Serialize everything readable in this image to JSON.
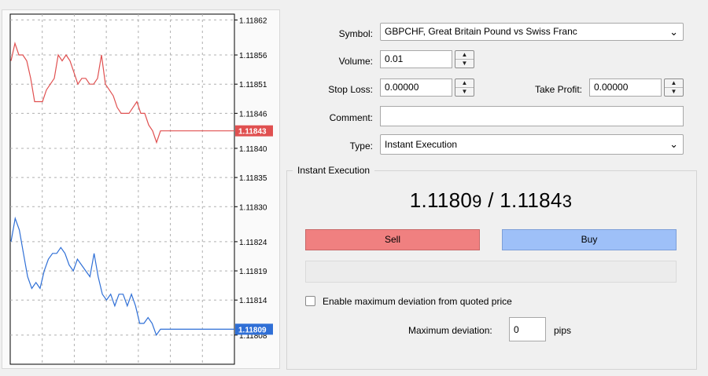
{
  "chart": {
    "price_ticks": [
      "1.11862",
      "1.11856",
      "1.11851",
      "1.11846",
      "1.11840",
      "1.11835",
      "1.11830",
      "1.11824",
      "1.11819",
      "1.11814",
      "1.11808"
    ],
    "ask_label": "1.11843",
    "bid_label": "1.11809",
    "ask_color": "#e05050",
    "bid_color": "#2f6fd6",
    "ask_series": [
      1.11855,
      1.11858,
      1.11856,
      1.11856,
      1.11855,
      1.11852,
      1.11848,
      1.11848,
      1.11848,
      1.1185,
      1.11851,
      1.11852,
      1.11856,
      1.11855,
      1.11856,
      1.11855,
      1.11853,
      1.11851,
      1.11852,
      1.11852,
      1.11851,
      1.11851,
      1.11852,
      1.11856,
      1.11851,
      1.1185,
      1.11849,
      1.11847,
      1.11846,
      1.11846,
      1.11846,
      1.11847,
      1.11848,
      1.11846,
      1.11846,
      1.11844,
      1.11843,
      1.11841,
      1.11843
    ],
    "bid_series": [
      1.11824,
      1.11828,
      1.11826,
      1.11822,
      1.11818,
      1.11816,
      1.11817,
      1.11816,
      1.11819,
      1.11821,
      1.11822,
      1.11822,
      1.11823,
      1.11822,
      1.1182,
      1.11819,
      1.11821,
      1.1182,
      1.11819,
      1.11818,
      1.11822,
      1.11818,
      1.11815,
      1.11814,
      1.11815,
      1.11813,
      1.11815,
      1.11815,
      1.11813,
      1.11815,
      1.11813,
      1.1181,
      1.1181,
      1.11811,
      1.1181,
      1.11808,
      1.11809
    ]
  },
  "form": {
    "symbol_label": "Symbol:",
    "symbol_value": "GBPCHF, Great Britain Pound vs Swiss Franc",
    "volume_label": "Volume:",
    "volume_value": "0.01",
    "stoploss_label": "Stop Loss:",
    "stoploss_value": "0.00000",
    "takeprofit_label": "Take Profit:",
    "takeprofit_value": "0.00000",
    "comment_label": "Comment:",
    "comment_value": "",
    "type_label": "Type:",
    "type_value": "Instant Execution"
  },
  "execution": {
    "group_title": "Instant Execution",
    "bid_main": "1.1180",
    "bid_last": "9",
    "separator": " / ",
    "ask_main": "1.1184",
    "ask_last": "3",
    "sell_label": "Sell",
    "buy_label": "Buy",
    "deviation_checkbox_label": "Enable maximum deviation from quoted price",
    "deviation_label": "Maximum deviation:",
    "deviation_value": "0",
    "deviation_unit": "pips"
  },
  "icons": {
    "dropdown": "chevron-down-icon",
    "spin_up": "arrow-up-icon",
    "spin_down": "arrow-down-icon"
  }
}
